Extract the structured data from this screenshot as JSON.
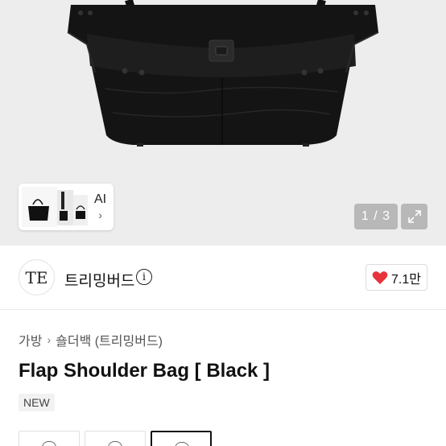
{
  "gallery": {
    "counter": "1 / 3",
    "ai_label": "AI",
    "ai_chevron": "›"
  },
  "brand": {
    "logo_text": "TE",
    "name": "트리밍버드",
    "info_icon": "i",
    "like_count": "7.1만"
  },
  "product": {
    "breadcrumb": [
      "가방",
      "숄더백 (트리밍버드)"
    ],
    "breadcrumb_sep": "›",
    "title": "Flap Shoulder Bag [ Black ]",
    "badge": "NEW"
  },
  "colors": {
    "heart": "#e8323c",
    "hero_bg": "#ededed"
  }
}
